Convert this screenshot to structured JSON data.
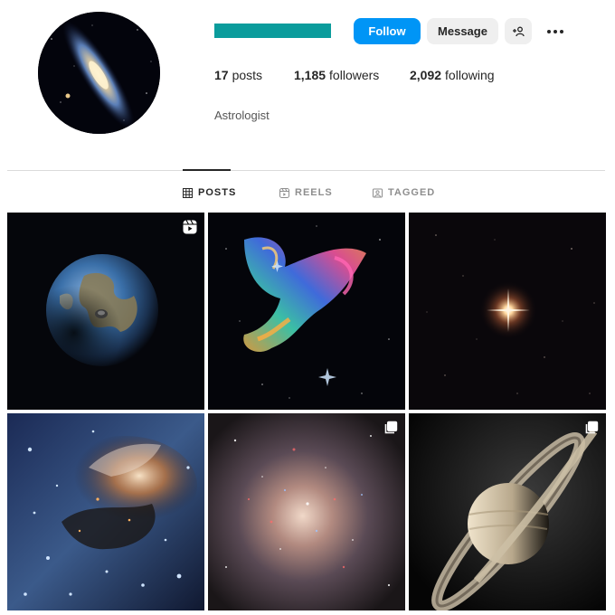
{
  "profile": {
    "username_bar_color": "#0b9c9c",
    "bio": "Astrologist",
    "avatar_icon": "galaxy-avatar"
  },
  "actions": {
    "follow_label": "Follow",
    "follow_color": "#0095f6",
    "message_label": "Message",
    "suggest_icon": "add-person-icon",
    "more_icon": "ellipsis-icon"
  },
  "stats": {
    "posts_count": "17",
    "posts_label": "posts",
    "followers_count": "1,185",
    "followers_label": "followers",
    "following_count": "2,092",
    "following_label": "following"
  },
  "tabs": [
    {
      "label": "POSTS",
      "icon": "grid-icon",
      "active": true
    },
    {
      "label": "REELS",
      "icon": "reels-icon",
      "active": false
    },
    {
      "label": "TAGGED",
      "icon": "tagged-icon",
      "active": false
    }
  ],
  "posts": [
    {
      "subject": "earth",
      "badge": "reel-icon"
    },
    {
      "subject": "colorful-nebula",
      "badge": ""
    },
    {
      "subject": "bright-star",
      "badge": ""
    },
    {
      "subject": "star-forming-region",
      "badge": ""
    },
    {
      "subject": "spiral-galaxy",
      "badge": "carousel-icon"
    },
    {
      "subject": "saturn",
      "badge": "carousel-icon"
    }
  ]
}
